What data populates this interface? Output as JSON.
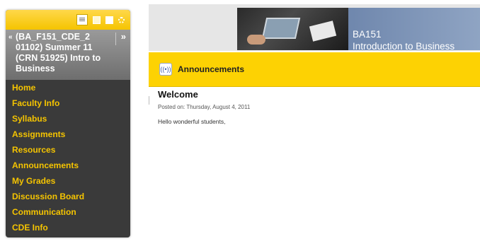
{
  "course_menu": {
    "toolbar_icons": [
      "list-view-icon",
      "folder-view-icon",
      "window-icon",
      "settings-icon"
    ],
    "course_title": "(BA_F151_CDE_2 01102) Summer 11 (CRN 51925) Intro to Business",
    "collapse_glyph": "«",
    "expand_glyph": "»",
    "items": [
      {
        "label": "Home"
      },
      {
        "label": "Faculty Info"
      },
      {
        "label": "Syllabus"
      },
      {
        "label": "Assignments"
      },
      {
        "label": "Resources"
      },
      {
        "label": "Announcements"
      },
      {
        "label": "My Grades"
      },
      {
        "label": "Discussion Board"
      },
      {
        "label": "Communication"
      },
      {
        "label": "CDE Info"
      }
    ],
    "colors": {
      "accent": "#f5c400",
      "background": "#3a3a3a"
    }
  },
  "banner": {
    "course_code": "BA151",
    "course_name": "Introduction to Business",
    "color": "#7f96b8"
  },
  "announcements": {
    "title": "Announcements",
    "icon": "announcement-icon",
    "bar_color": "#fdd203"
  },
  "post": {
    "heading": "Welcome",
    "posted_on": "Posted on: Thursday, August 4, 2011",
    "body": "Hello wonderful students,"
  }
}
